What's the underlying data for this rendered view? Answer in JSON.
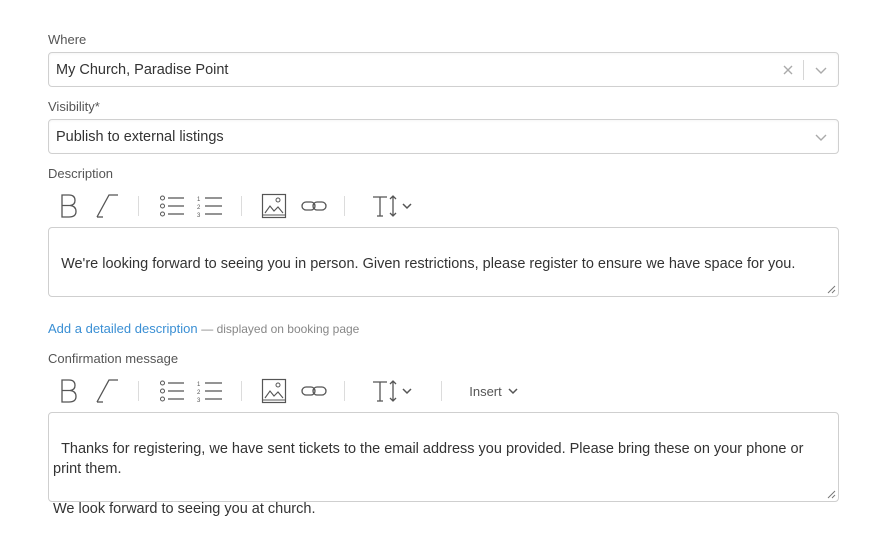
{
  "where": {
    "label": "Where",
    "value": "My Church, Paradise Point"
  },
  "visibility": {
    "label": "Visibility*",
    "value": "Publish to external listings"
  },
  "description": {
    "label": "Description",
    "text": "We're looking forward to seeing you in person. Given restrictions, please register to ensure we have space for you."
  },
  "detailed": {
    "link": "Add a detailed description",
    "hint": "— displayed on booking page"
  },
  "confirmation": {
    "label": "Confirmation message",
    "text": "Thanks for registering, we have sent tickets to the email address you provided. Please bring these on your phone or print them.\n\nWe look forward to seeing you at church.",
    "insert_label": "Insert"
  },
  "toolbar_icons": [
    "bold-icon",
    "italic-icon",
    "bullet-list-icon",
    "numbered-list-icon",
    "image-icon",
    "link-icon",
    "text-size-icon",
    "chevron-down-icon"
  ],
  "colors": {
    "link": "#3a8fd4",
    "border": "#d0d0d0",
    "icon": "#555555"
  }
}
